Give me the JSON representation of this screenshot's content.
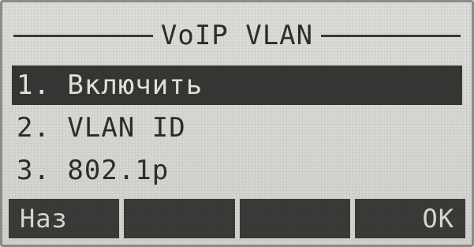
{
  "screen": {
    "title": "VoIP VLAN"
  },
  "menu": {
    "items": [
      {
        "label": "1. Включить",
        "selected": true
      },
      {
        "label": "2. VLAN ID",
        "selected": false
      },
      {
        "label": "3. 802.1p",
        "selected": false
      }
    ]
  },
  "softkeys": [
    {
      "label": "Наз"
    },
    {
      "label": ""
    },
    {
      "label": ""
    },
    {
      "label": "OK"
    }
  ]
}
